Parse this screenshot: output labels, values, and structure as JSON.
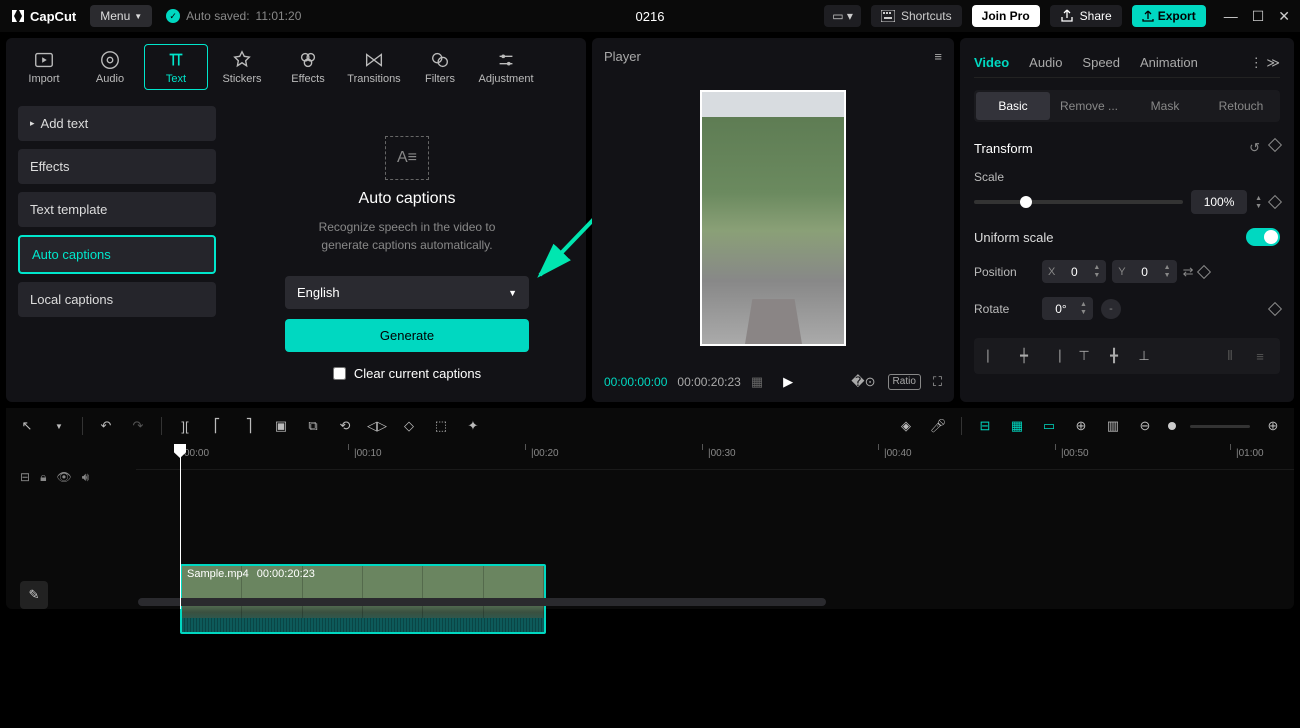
{
  "app": {
    "name": "CapCut",
    "menu": "Menu"
  },
  "autosave": {
    "label": "Auto saved:",
    "time": "11:01:20"
  },
  "project": {
    "name": "0216"
  },
  "topbar": {
    "shortcuts": "Shortcuts",
    "joinpro": "Join Pro",
    "share": "Share",
    "export": "Export"
  },
  "tooltabs": {
    "import": "Import",
    "audio": "Audio",
    "text": "Text",
    "stickers": "Stickers",
    "effects": "Effects",
    "transitions": "Transitions",
    "filters": "Filters",
    "adjustment": "Adjustment"
  },
  "sidelist": {
    "addText": "Add text",
    "effects": "Effects",
    "textTemplate": "Text template",
    "autoCaptions": "Auto captions",
    "localCaptions": "Local captions"
  },
  "panel": {
    "title": "Auto captions",
    "desc": "Recognize speech in the video to generate captions automatically.",
    "language": "English",
    "generate": "Generate",
    "clear": "Clear current captions"
  },
  "player": {
    "title": "Player",
    "currentTime": "00:00:00:00",
    "duration": "00:00:20:23",
    "ratio": "Ratio"
  },
  "inspector": {
    "tabs": {
      "video": "Video",
      "audio": "Audio",
      "speed": "Speed",
      "animation": "Animation"
    },
    "subtabs": {
      "basic": "Basic",
      "remove": "Remove ...",
      "mask": "Mask",
      "retouch": "Retouch"
    },
    "transform": "Transform",
    "scale": {
      "label": "Scale",
      "value": "100%"
    },
    "uniform": "Uniform scale",
    "position": {
      "label": "Position",
      "x": "0",
      "y": "0"
    },
    "rotate": {
      "label": "Rotate",
      "value": "0°"
    }
  },
  "clip": {
    "name": "Sample.mp4",
    "duration": "00:00:20:23"
  },
  "ruler": [
    "00:00",
    "|00:10",
    "|00:20",
    "|00:30",
    "|00:40",
    "|00:50",
    "|01:00"
  ]
}
